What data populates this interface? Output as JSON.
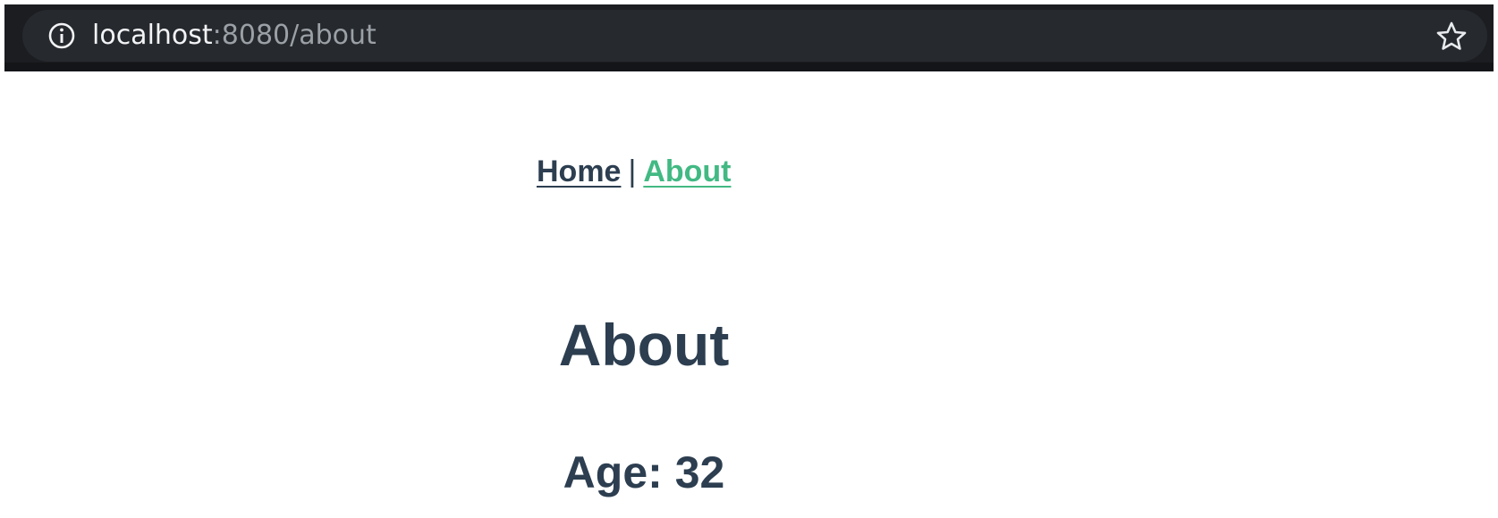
{
  "browser": {
    "url_host": "localhost",
    "url_rest": ":8080/about",
    "info_icon": "info-icon",
    "bookmark_icon": "star-outline-icon"
  },
  "nav": {
    "home_label": "Home",
    "separator": "|",
    "about_label": "About",
    "active_color": "#42b983",
    "text_color": "#2c3e50"
  },
  "page": {
    "title": "About",
    "age_label": "Age:",
    "age_value": "32"
  }
}
